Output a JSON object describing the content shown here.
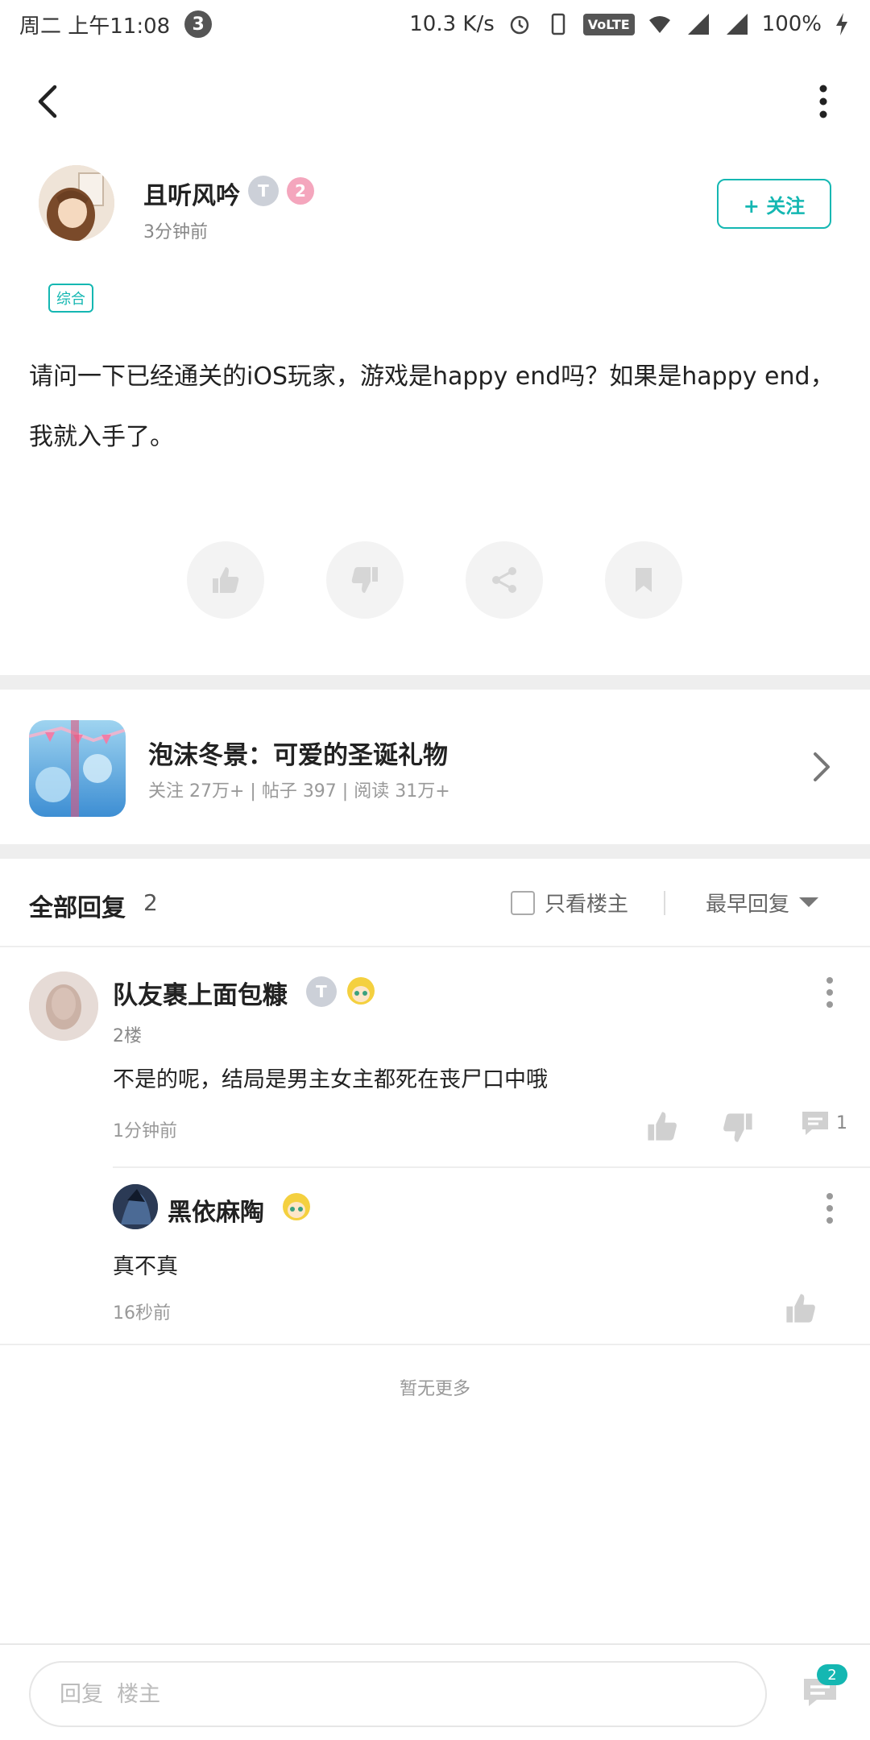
{
  "status_bar": {
    "time": "周二 上午11:08",
    "notification_count": "3",
    "network_speed": "10.3 K/s",
    "volte": "VoLTE",
    "battery": "100%"
  },
  "post": {
    "author_name": "且听风吟",
    "author_level_badge": "T",
    "author_rank": "2",
    "time_ago": "3分钟前",
    "follow_label": "+ 关注",
    "tag": "综合",
    "content": "请问一下已经通关的iOS玩家，游戏是happy end吗？如果是happy end，我就入手了。"
  },
  "game": {
    "title": "泡沫冬景：可爱的圣诞礼物",
    "stats": "关注 27万+  |  帖子 397  |  阅读 31万+"
  },
  "replies_header": {
    "title": "全部回复",
    "count": "2",
    "only_op_label": "只看楼主",
    "sort_label": "最早回复"
  },
  "comments": [
    {
      "name": "队友裹上面包糠",
      "level_badge": "T",
      "floor": "2楼",
      "text": "不是的呢，结局是男主女主都死在丧尸口中哦",
      "time": "1分钟前",
      "reply_count": "1"
    }
  ],
  "sub_reply": {
    "name": "黑依麻陶",
    "text": "真不真",
    "time": "16秒前"
  },
  "footer": {
    "no_more": "暂无更多",
    "reply_placeholder": "回复  楼主",
    "chat_count": "2"
  },
  "colors": {
    "accent": "#14b7b2",
    "pink_badge": "#f4a6bd"
  },
  "icons": [
    "back-icon",
    "more-vertical-icon",
    "thumbs-up-icon",
    "thumbs-down-icon",
    "share-icon",
    "bookmark-icon",
    "chevron-right-icon",
    "checkbox-icon",
    "caret-down-icon",
    "comment-icon"
  ]
}
